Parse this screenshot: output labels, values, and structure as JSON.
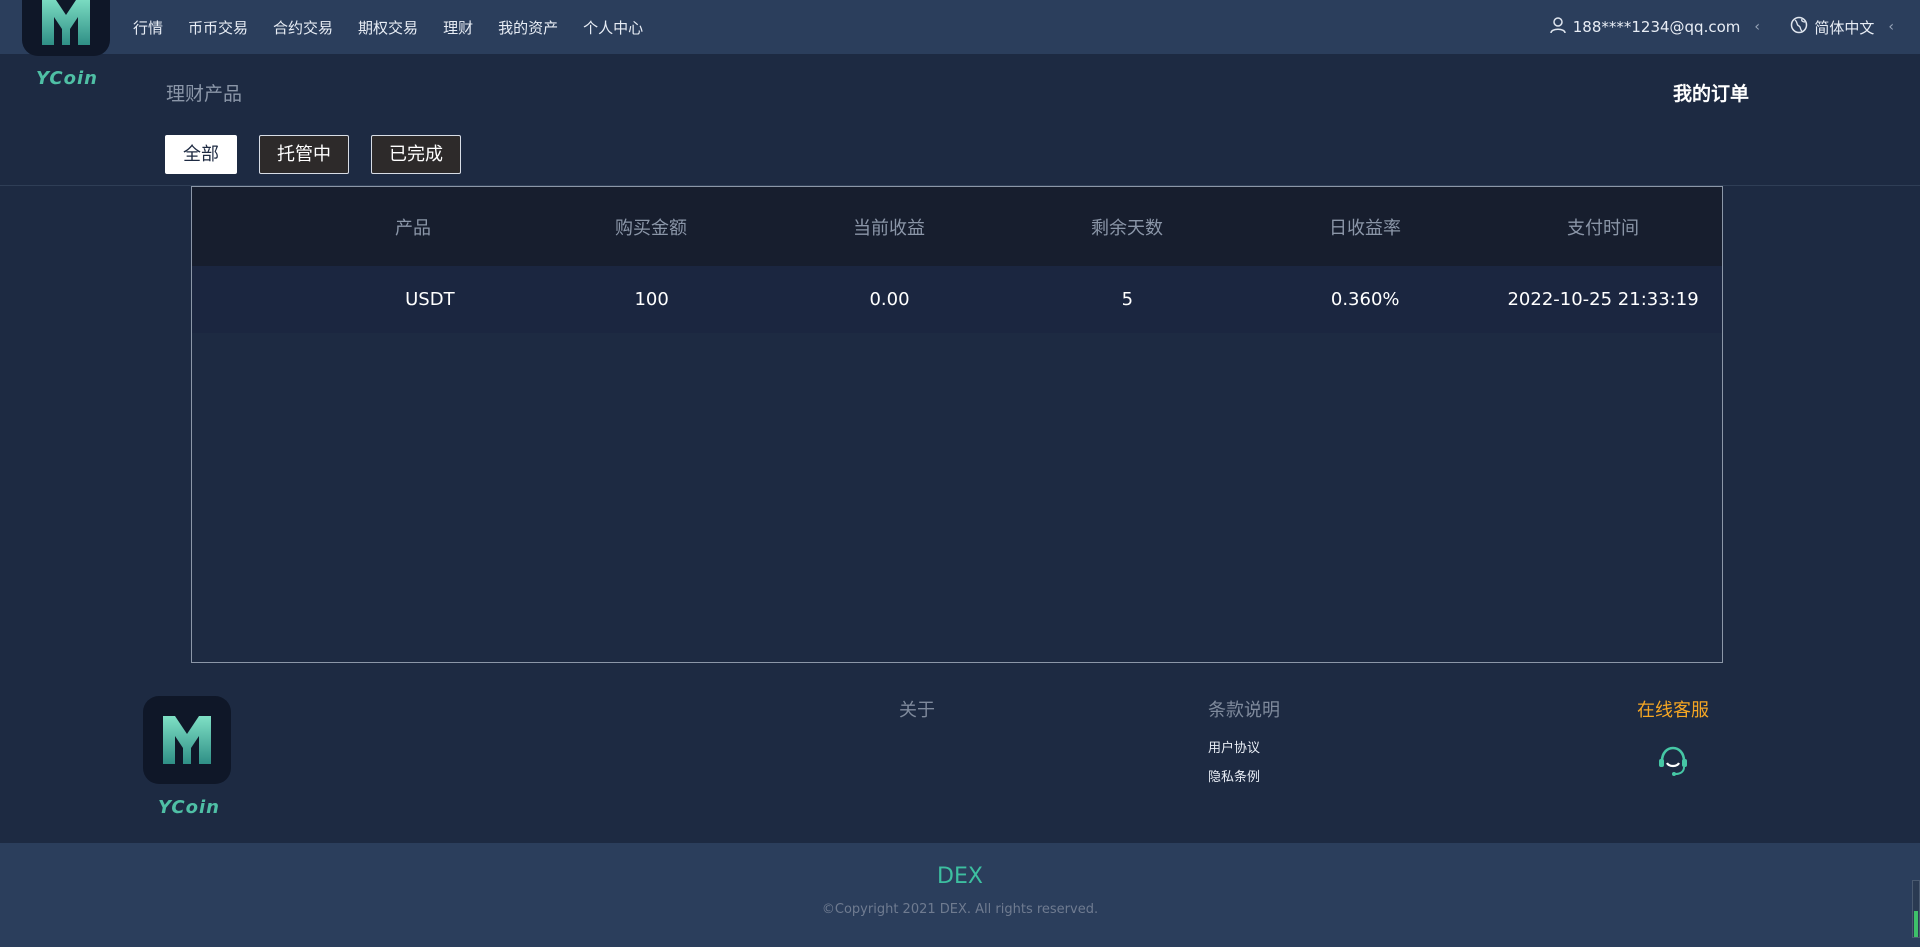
{
  "brand": {
    "logo_text": "YCoin"
  },
  "nav": {
    "items": [
      {
        "label": "行情"
      },
      {
        "label": "币币交易"
      },
      {
        "label": "合约交易"
      },
      {
        "label": "期权交易"
      },
      {
        "label": "理财"
      },
      {
        "label": "我的资产"
      },
      {
        "label": "个人中心"
      }
    ]
  },
  "user": {
    "account": "188****1234@qq.com"
  },
  "language": {
    "selected": "简体中文"
  },
  "page": {
    "subtitle": "理财产品",
    "right_title": "我的订单"
  },
  "filters": [
    {
      "label": "全部",
      "active": true
    },
    {
      "label": "托管中",
      "active": false
    },
    {
      "label": "已完成",
      "active": false
    }
  ],
  "table": {
    "headers": [
      "产品",
      "购买金额",
      "当前收益",
      "剩余天数",
      "日收益率",
      "支付时间"
    ],
    "rows": [
      [
        "USDT",
        "100",
        "0.00",
        "5",
        "0.360%",
        "2022-10-25 21:33:19"
      ]
    ]
  },
  "footer": {
    "about_title": "关于",
    "terms_title": "条款说明",
    "terms_links": [
      "用户协议",
      "隐私条例"
    ],
    "support_title": "在线客服",
    "brand": "DEX",
    "copyright": "©Copyright 2021 DEX. All rights reserved."
  },
  "colors": {
    "accent": "#3dbfa0",
    "support": "#f5a623",
    "background": "#1d2a42",
    "header": "#2b3e5c"
  },
  "icons": {
    "user": "user-icon",
    "globe": "globe-icon",
    "chevron": "chevron-left-icon",
    "headset": "headset-icon"
  }
}
